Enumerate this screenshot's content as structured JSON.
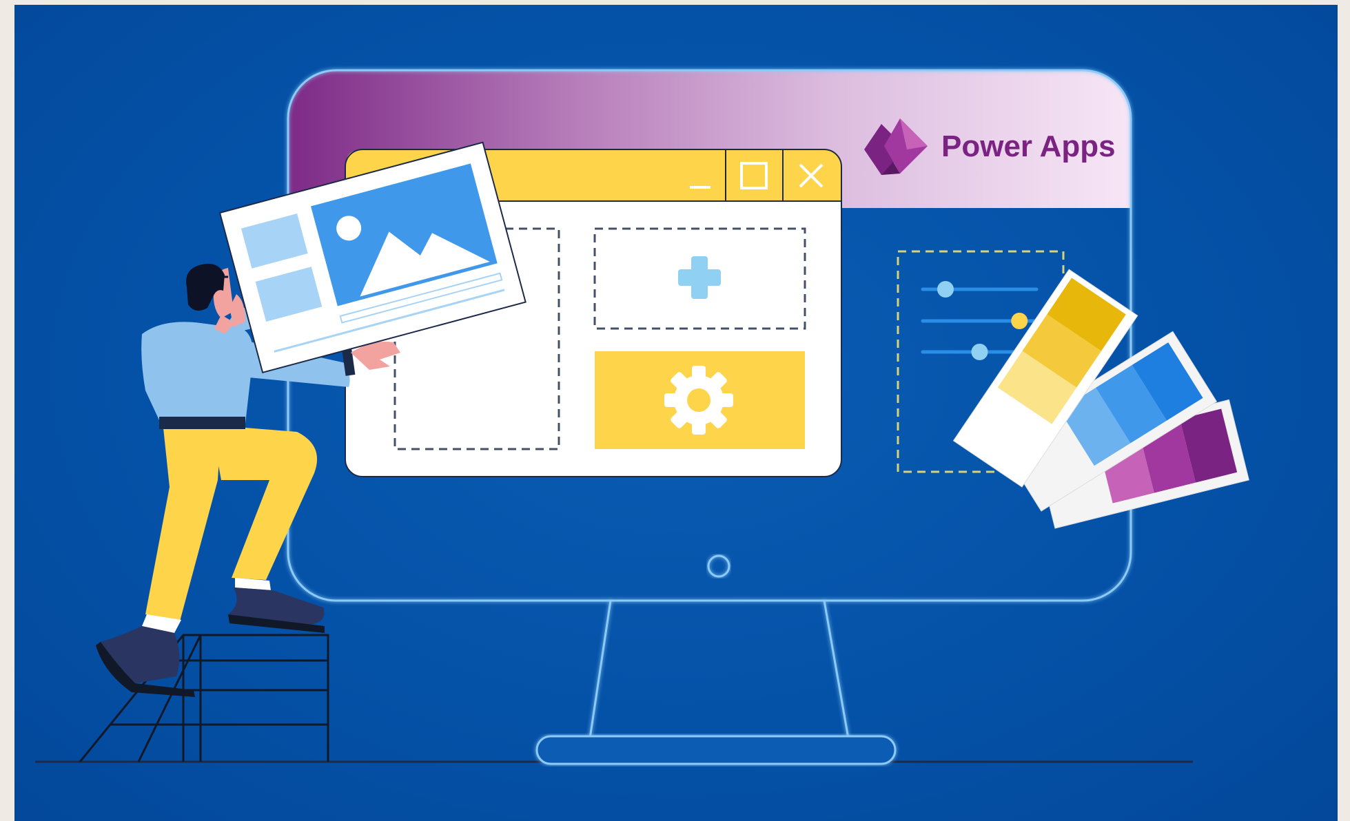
{
  "brand": {
    "name": "Power Apps",
    "logo_icon": "power-apps-logo-icon",
    "color": "#7b2382"
  },
  "app_window": {
    "controls": [
      "minimize-icon",
      "maximize-icon",
      "close-icon"
    ],
    "title_bar_color": "#fdd44a",
    "tiles": [
      "add-icon",
      "gear-icon"
    ]
  },
  "settings_panel": {
    "sliders": [
      {
        "name": "slider-1",
        "value": 0.2,
        "knob_color": "#8fd0f3"
      },
      {
        "name": "slider-2",
        "value": 0.85,
        "knob_color": "#fdd44a"
      },
      {
        "name": "slider-3",
        "value": 0.5,
        "knob_color": "#8fd0f3"
      }
    ]
  },
  "palette": {
    "swatch_strips": [
      [
        "#e8b70c",
        "#f4c93b",
        "#fbe38a",
        "#ffffff"
      ],
      [
        "#1f7fe0",
        "#3f98ea",
        "#6cb2ef",
        "#ffffff"
      ],
      [
        "#7b2382",
        "#a1389f",
        "#c663b8",
        "#ffffff"
      ]
    ]
  },
  "colors": {
    "background": "#0452a8",
    "outline": "#7fc2f5",
    "yellow": "#fdd44a",
    "purple": "#7b2382"
  }
}
